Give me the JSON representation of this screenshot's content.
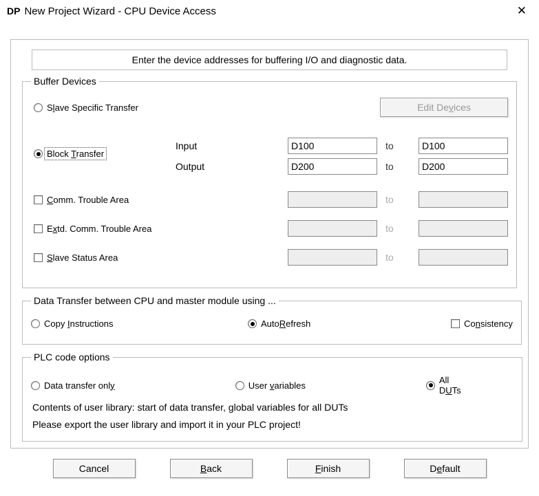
{
  "window": {
    "app_icon": "DP",
    "title": "New Project Wizard - CPU Device Access"
  },
  "instruction": "Enter the device addresses for buffering I/O and diagnostic data.",
  "buffer": {
    "legend": "Buffer Devices",
    "slave_specific": "Slave Specific Transfer",
    "edit_devices": "Edit Devices",
    "block_transfer": "Block Transfer",
    "input_label": "Input",
    "output_label": "Output",
    "to": "to",
    "input_from": "D100",
    "input_to": "D100",
    "output_from": "D200",
    "output_to": "D200",
    "comm_trouble": "Comm. Trouble Area",
    "extd_trouble": "Extd. Comm. Trouble Area",
    "slave_status": "Slave Status Area"
  },
  "transfer": {
    "legend": "Data Transfer between CPU and master module using ...",
    "copy": "Copy Instructions",
    "auto": "AutoRefresh",
    "consistency": "Consistency"
  },
  "plc": {
    "legend": "PLC code options",
    "data_only": "Data transfer only",
    "user_vars": "User variables",
    "all_duts": "All DUTs",
    "text1": "Contents of user library: start of data transfer, global variables for all DUTs",
    "text2": "Please export the user library and import it in your PLC project!"
  },
  "buttons": {
    "cancel": "Cancel",
    "back": "Back",
    "finish": "Finish",
    "default": "Default"
  }
}
